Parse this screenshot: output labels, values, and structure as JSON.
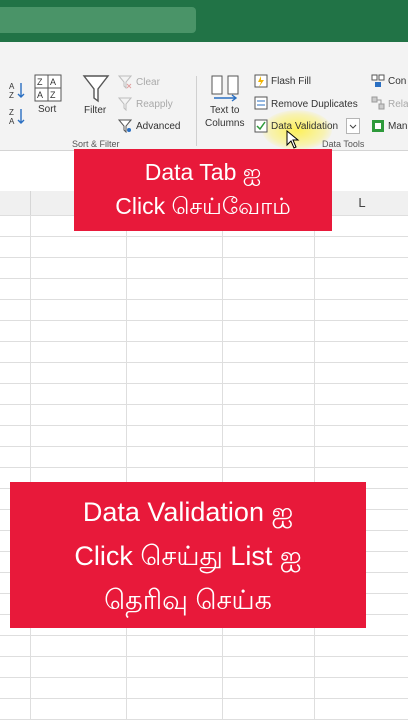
{
  "ribbon": {
    "sort_filter": {
      "sort_label": "Sort",
      "filter_label": "Filter",
      "clear_label": "Clear",
      "reapply_label": "Reapply",
      "advanced_label": "Advanced",
      "group_label": "Sort & Filter"
    },
    "data_tools": {
      "text_to_columns_line1": "Text to",
      "text_to_columns_line2": "Columns",
      "flash_fill_label": "Flash Fill",
      "remove_duplicates_label": "Remove Duplicates",
      "data_validation_label": "Data Validation",
      "group_label": "Data Tools"
    },
    "right_partial": {
      "con_label": "Con",
      "rela_label": "Rela",
      "man_label": "Man"
    }
  },
  "sheet": {
    "visible_column_header": "L"
  },
  "banners": {
    "top": {
      "line1": "Data Tab ஐ",
      "line2": "Click செய்வோம்"
    },
    "bottom": {
      "line1": "Data Validation ஐ",
      "line2": "Click  செய்து List ஐ",
      "line3": "தெரிவு செய்க"
    }
  },
  "colors": {
    "excel_green": "#217346",
    "banner_red": "#e8193a",
    "highlight_yellow": "#fff03c"
  }
}
